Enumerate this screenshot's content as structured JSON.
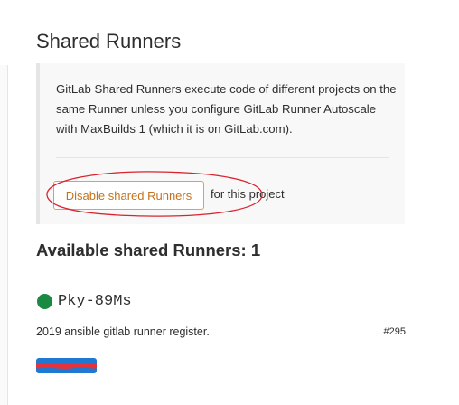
{
  "section": {
    "title": "Shared Runners"
  },
  "info_box": {
    "description": "GitLab Shared Runners execute code of different projects on the same Runner unless you configure GitLab Runner Autoscale with MaxBuilds 1 (which it is on GitLab.com)."
  },
  "actions": {
    "disable_label": "Disable shared Runners",
    "suffix_text": "for this project"
  },
  "available": {
    "heading": "Available shared Runners: 1"
  },
  "runner": {
    "name": "Pky-89Ms",
    "description": "2019 ansible gitlab runner register.",
    "id": "#295",
    "status": "online",
    "status_color": "#1a8a42",
    "tag_color": "#1f78d1",
    "redaction_color": "#e8323a"
  },
  "annotation": {
    "color": "#d9232e"
  }
}
